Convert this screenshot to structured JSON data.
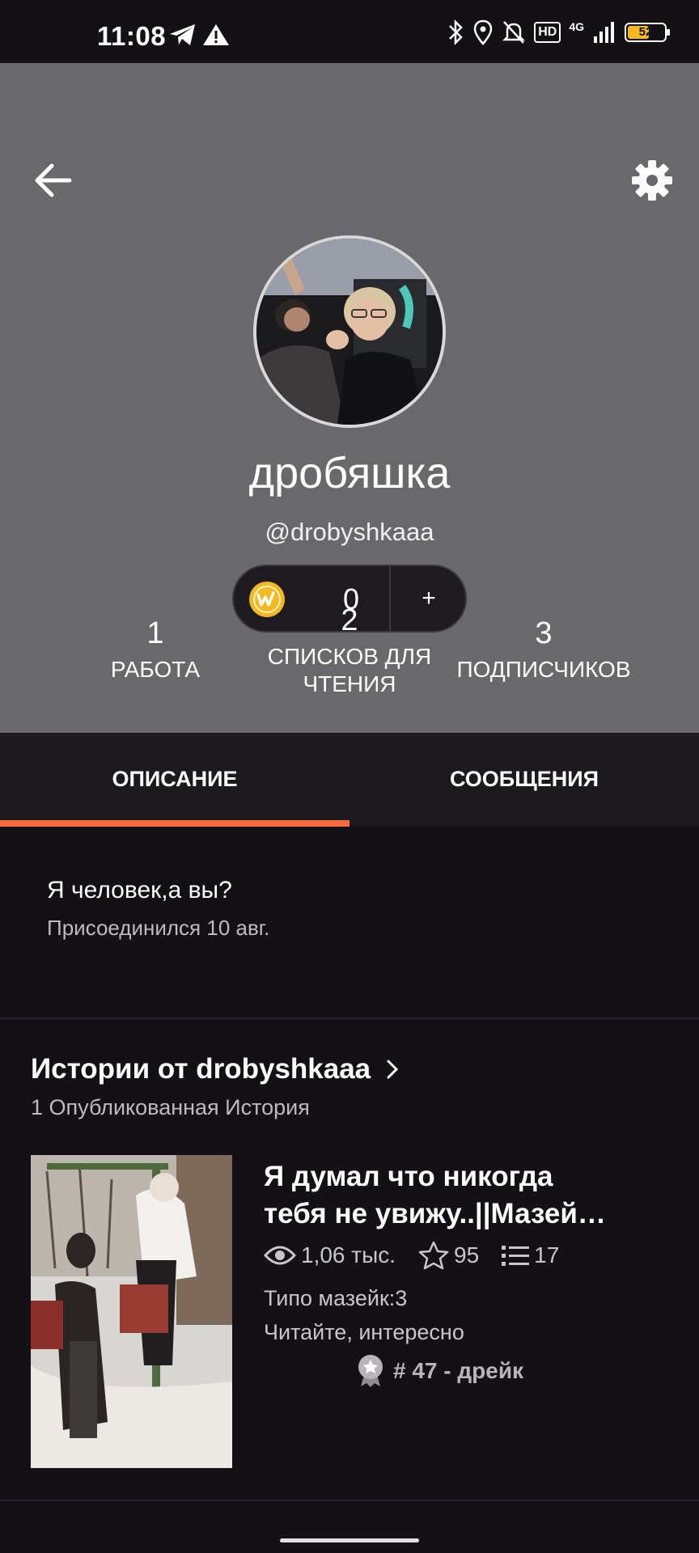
{
  "status_bar": {
    "time": "11:08",
    "battery": "52",
    "network": "4G",
    "hd": "HD"
  },
  "profile": {
    "display_name": "дробяшка",
    "username": "@drobyshkaaa",
    "coins": "0",
    "add_coins_label": "+"
  },
  "stats": [
    {
      "value": "1",
      "label": "РАБОТА"
    },
    {
      "value": "2",
      "label_line1": "СПИСКОВ ДЛЯ",
      "label_line2": "ЧТЕНИЯ"
    },
    {
      "value": "3",
      "label": "ПОДПИСЧИКОВ"
    }
  ],
  "tabs": [
    {
      "label": "ОПИСАНИЕ",
      "active": true
    },
    {
      "label": "СООБЩЕНИЯ",
      "active": false
    }
  ],
  "about": {
    "text": "Я человек,а вы?",
    "joined": "Присоединился 10 авг."
  },
  "stories": {
    "title": "Истории от drobyshkaaa",
    "count": "1 Опубликованная История",
    "items": [
      {
        "title_line1": "Я думал что никогда",
        "title_line2": "тебя не увижу..||Мазей…",
        "reads": "1,06 тыс.",
        "votes": "95",
        "parts": "17",
        "tag1": "Типо мазейк:3",
        "tag2": "Читайте, интересно",
        "rank": "# 47 - дрейк"
      }
    ]
  },
  "colors": {
    "accent": "#ff6a3d",
    "header_bg": "#69686b",
    "page_bg": "#141116",
    "coin": "#f5b820"
  },
  "icons": [
    "back-arrow-icon",
    "gear-icon",
    "coin-icon",
    "eye-icon",
    "star-icon",
    "list-icon",
    "chevron-right-icon",
    "award-icon"
  ]
}
